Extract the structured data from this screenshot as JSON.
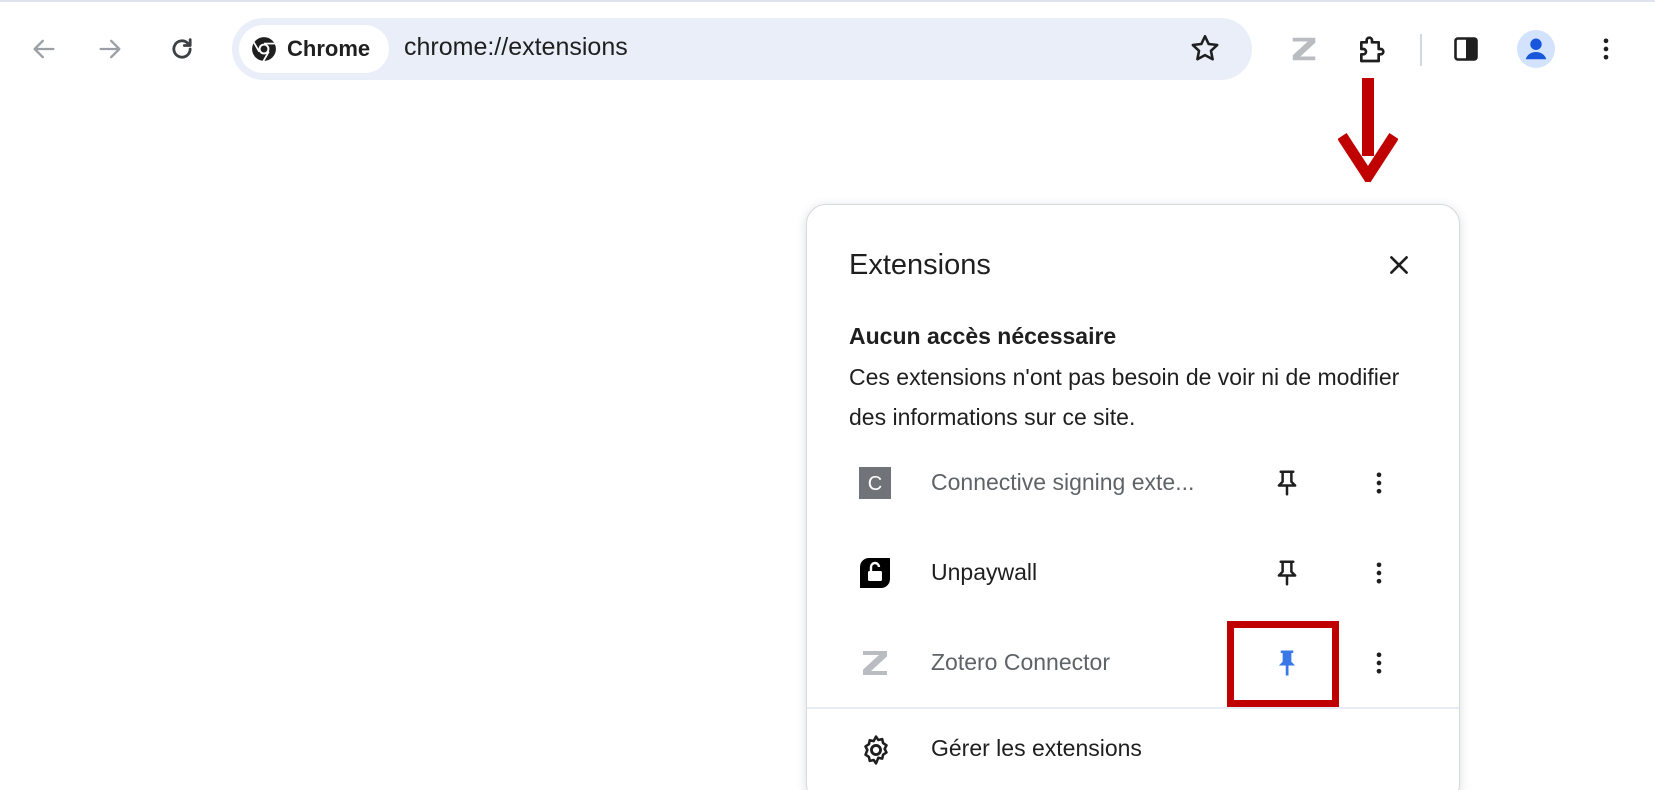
{
  "browser": {
    "chip_label": "Chrome",
    "url": "chrome://extensions"
  },
  "toolbar_icons": [
    "back-arrow-icon",
    "forward-arrow-icon",
    "reload-icon",
    "bookmark-star-icon",
    "zotero-icon",
    "extensions-puzzle-icon",
    "side-panel-icon",
    "profile-avatar-icon",
    "more-vert-icon"
  ],
  "popup": {
    "title": "Extensions",
    "section_title": "Aucun accès nécessaire",
    "section_description": "Ces extensions n'ont pas besoin de voir ni de modifier des informations sur ce site.",
    "extensions": [
      {
        "name": "Connective signing exte...",
        "icon": "connective-c-icon",
        "pinned": false
      },
      {
        "name": "Unpaywall",
        "icon": "unpaywall-lock-icon",
        "pinned": false
      },
      {
        "name": "Zotero Connector",
        "icon": "zotero-z-icon",
        "pinned": true
      }
    ],
    "manage_label": "Gérer les extensions"
  },
  "colors": {
    "omnibox_bg": "#e9eef8",
    "annotation_red": "#c00000",
    "pinned_blue": "#3b78e7",
    "avatar_blue": "#1a56db"
  }
}
